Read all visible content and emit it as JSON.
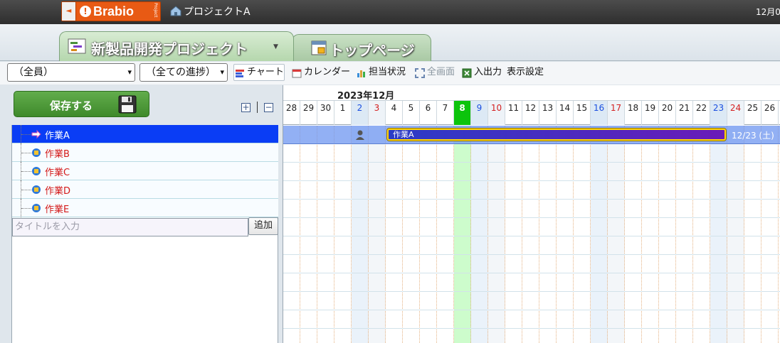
{
  "header": {
    "logo_text": "Brabio",
    "logo_mark": "!",
    "logo_sub": "Project",
    "project_crumb": "プロジェクトA",
    "date": "12月0"
  },
  "tabs": [
    {
      "label": "新製品開発プロジェクト",
      "icon": "gantt-chart-icon",
      "active": true
    },
    {
      "label": "トップページ",
      "icon": "calendar-page-icon",
      "active": false
    }
  ],
  "toolbar": {
    "member_filter": "（全員）",
    "progress_filter": "（全ての進捗）",
    "chart": "チャート",
    "calendar": "カレンダー",
    "assignment": "担当状況",
    "fullscreen": "全画面",
    "import_export": "入出力",
    "display_settings": "表示設定"
  },
  "left": {
    "save_label": "保存する",
    "expand_symbol": "+",
    "collapse_symbol": "−",
    "tasks": [
      {
        "label": "作業A",
        "selected": true
      },
      {
        "label": "作業B",
        "selected": false
      },
      {
        "label": "作業C",
        "selected": false
      },
      {
        "label": "作業D",
        "selected": false
      },
      {
        "label": "作業E",
        "selected": false
      }
    ],
    "title_placeholder": "タイトルを入力",
    "add_label": "追加"
  },
  "gantt": {
    "month": "2023年12月",
    "days": [
      {
        "d": "28",
        "type": "weekday"
      },
      {
        "d": "29",
        "type": "weekday"
      },
      {
        "d": "30",
        "type": "weekday"
      },
      {
        "d": "1",
        "type": "weekday"
      },
      {
        "d": "2",
        "type": "sat"
      },
      {
        "d": "3",
        "type": "sun"
      },
      {
        "d": "4",
        "type": "weekday"
      },
      {
        "d": "5",
        "type": "weekday"
      },
      {
        "d": "6",
        "type": "weekday"
      },
      {
        "d": "7",
        "type": "weekday"
      },
      {
        "d": "8",
        "type": "today"
      },
      {
        "d": "9",
        "type": "sat"
      },
      {
        "d": "10",
        "type": "sun"
      },
      {
        "d": "11",
        "type": "weekday"
      },
      {
        "d": "12",
        "type": "weekday"
      },
      {
        "d": "13",
        "type": "weekday"
      },
      {
        "d": "14",
        "type": "weekday"
      },
      {
        "d": "15",
        "type": "weekday"
      },
      {
        "d": "16",
        "type": "sat"
      },
      {
        "d": "17",
        "type": "sun"
      },
      {
        "d": "18",
        "type": "weekday"
      },
      {
        "d": "19",
        "type": "weekday"
      },
      {
        "d": "20",
        "type": "weekday"
      },
      {
        "d": "21",
        "type": "weekday"
      },
      {
        "d": "22",
        "type": "weekday"
      },
      {
        "d": "23",
        "type": "sat"
      },
      {
        "d": "24",
        "type": "sun"
      },
      {
        "d": "25",
        "type": "weekday"
      },
      {
        "d": "26",
        "type": "weekday"
      }
    ],
    "bar": {
      "label": "作業A",
      "start_day": "4",
      "end_day": "23",
      "end_label": "12/23 (土)",
      "assignee_day": "2"
    }
  },
  "colors": {
    "selected_row": "#0a3df5",
    "today": "#0cc40c",
    "task_text": "#d41a1a",
    "bar_start": "#2a3cc6",
    "bar_end": "#6a1bb8",
    "bar_border": "#ffd400"
  }
}
